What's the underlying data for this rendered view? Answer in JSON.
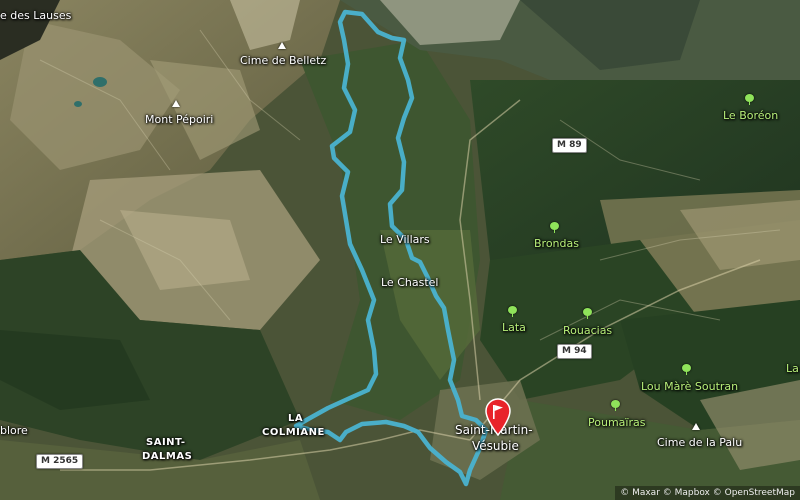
{
  "map": {
    "labels": {
      "lac_des_lauses": "e des Lauses",
      "cime_de_belletz": "Cime de Belletz",
      "mont_pepoiri": "Mont Pépoiri",
      "le_boreon": "Le Boréon",
      "le_villars": "Le Villars",
      "brondas": "Brondas",
      "le_chastel": "Le Chastel",
      "lata": "Lata",
      "rouacias": "Rouacias",
      "lou_mare_soutran": "Lou Màrè Soutran",
      "la_right": "La",
      "poumairas": "Poumaïras",
      "cime_de_la_palu": "Cime de la Palu",
      "la_colmiane_1": "LA",
      "la_colmiane_2": "COLMIANE",
      "saint_martin_1": "Saint-Martin-",
      "saint_martin_2": "Vésubie",
      "saint_dalmas_1": "SAINT-",
      "saint_dalmas_2": "DALMAS",
      "blore": "blore"
    },
    "roads": {
      "m89": "M 89",
      "m94": "M 94",
      "m2565": "M 2565"
    },
    "colors": {
      "route": "#4ab3d0",
      "marker": "#e8232a",
      "place_label": "#ffffff",
      "nature_label": "#b8f07a"
    },
    "icons": {
      "peak": "peak-triangle-icon",
      "village": "tree-icon",
      "start": "flag-marker-icon"
    }
  },
  "attribution": "© Maxar © Mapbox © OpenStreetMap"
}
